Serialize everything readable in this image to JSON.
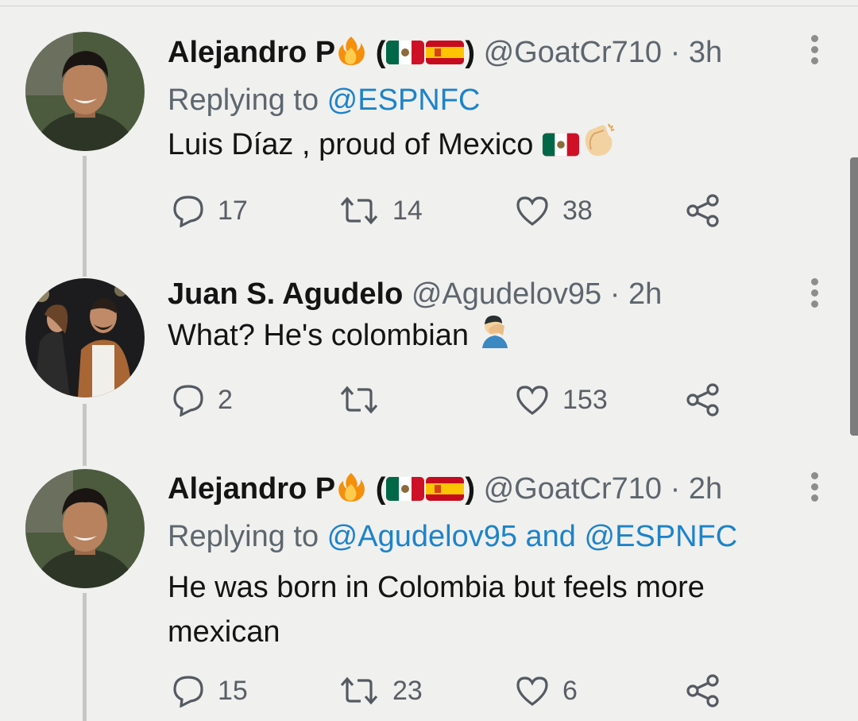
{
  "tweets": [
    {
      "name": "Alejandro P",
      "handle": "@GoatCr710",
      "time": "3h",
      "reply_prefix": "Replying to ",
      "reply_to": "@ESPNFC",
      "text": "Luis Díaz , proud of Mexico",
      "replies": "17",
      "retweets": "14",
      "likes": "38"
    },
    {
      "name": "Juan S. Agudelo",
      "handle": "@Agudelov95",
      "time": "2h",
      "text": "What? He's colombian",
      "replies": "2",
      "retweets": "",
      "likes": "153"
    },
    {
      "name": "Alejandro P",
      "handle": "@GoatCr710",
      "time": "2h",
      "reply_prefix": "Replying to ",
      "reply_to": "@Agudelov95 and @ESPNFC",
      "text_line1": "He was born in Colombia but feels more",
      "text_line2": "mexican",
      "replies": "15",
      "retweets": "23",
      "likes": "6"
    }
  ],
  "separator": " · ",
  "colors": {
    "link": "#1d83c9",
    "meta": "#5d666e",
    "background": "#f0f0ef"
  },
  "icons": [
    "fire-icon",
    "mexico-flag-icon",
    "spain-flag-icon",
    "clapping-hands-icon",
    "facepalm-icon",
    "reply-icon",
    "retweet-icon",
    "like-icon",
    "share-icon",
    "more-options-icon"
  ]
}
